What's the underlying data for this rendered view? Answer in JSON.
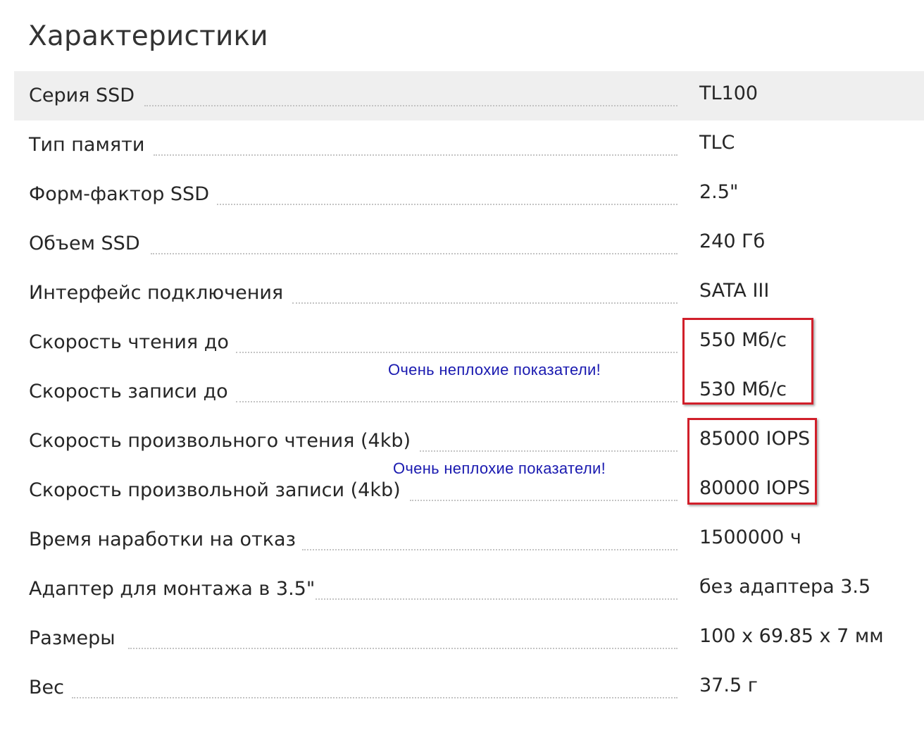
{
  "page_title": "Характеристики",
  "specs": [
    {
      "label": "Серия SSD",
      "value": "TL100"
    },
    {
      "label": "Тип памяти",
      "value": "TLC"
    },
    {
      "label": "Форм-фактор SSD",
      "value": "2.5\""
    },
    {
      "label": "Объем SSD",
      "value": "240 Гб"
    },
    {
      "label": "Интерфейс подключения",
      "value": "SATA III"
    },
    {
      "label": "Скорость чтения до",
      "value": "550 Мб/с"
    },
    {
      "label": "Скорость записи до",
      "value": "530 Мб/с"
    },
    {
      "label": "Скорость произвольного чтения (4kb)",
      "value": "85000 IOPS"
    },
    {
      "label": "Скорость произвольной записи (4kb)",
      "value": "80000 IOPS"
    },
    {
      "label": "Время наработки на отказ",
      "value": "1500000 ч"
    },
    {
      "label": "Адаптер для монтажа в 3.5\"",
      "value": "без адаптера 3.5"
    },
    {
      "label": "Размеры",
      "value": "100 x 69.85 x 7 мм"
    },
    {
      "label": "Вес",
      "value": "37.5 г"
    }
  ],
  "annotations": {
    "sequential_speed_note": "Очень неплохие показатели!",
    "random_speed_note": "Очень неплохие показатели!"
  },
  "colors": {
    "highlight_border": "#d11f2a",
    "annotation_text": "#1a1ab0",
    "shaded_row": "#efefef"
  }
}
